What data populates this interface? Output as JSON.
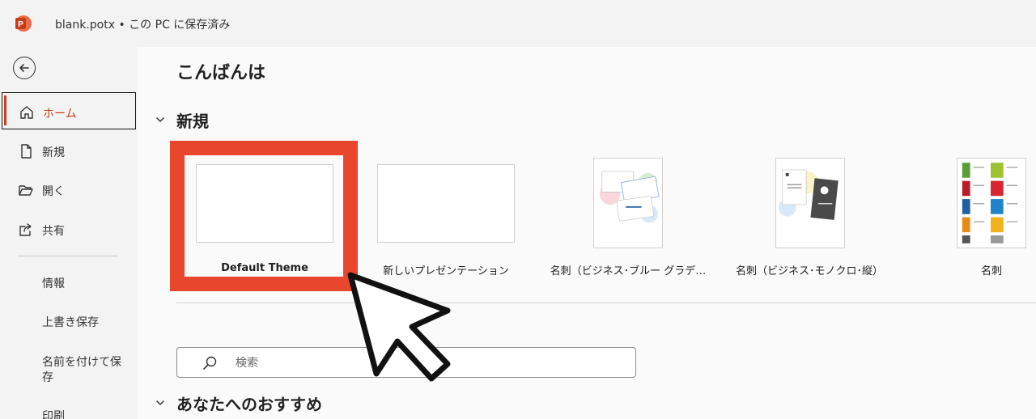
{
  "titlebar": {
    "file_title": "blank.potx • この PC に保存済み",
    "app_color": "#c43e1c"
  },
  "sidebar": {
    "back": "back-arrow-icon",
    "items": [
      {
        "label": "ホーム",
        "icon": "home-icon",
        "active": true
      },
      {
        "label": "新規",
        "icon": "new-document-icon"
      },
      {
        "label": "開く",
        "icon": "open-folder-icon"
      },
      {
        "label": "共有",
        "icon": "share-icon"
      }
    ],
    "text_items": [
      "情報",
      "上書き保存",
      "名前を付けて保存",
      "印刷"
    ]
  },
  "main": {
    "greeting": "こんばんは",
    "new_section": "新規",
    "templates": [
      {
        "label": "Default Theme",
        "highlighted": true
      },
      {
        "label": "新しいプレゼンテーション"
      },
      {
        "label": "名刺（ビジネス･ブルー グラデ…"
      },
      {
        "label": "名刺（ビジネス･モノクロ･縦）"
      },
      {
        "label": "名刺"
      }
    ],
    "search": {
      "placeholder": "検索",
      "icon": "search-icon"
    },
    "recommend_section": "あなたへのおすすめ"
  },
  "colors": {
    "accent": "#c43e1c",
    "highlight_border": "#e8472e"
  }
}
